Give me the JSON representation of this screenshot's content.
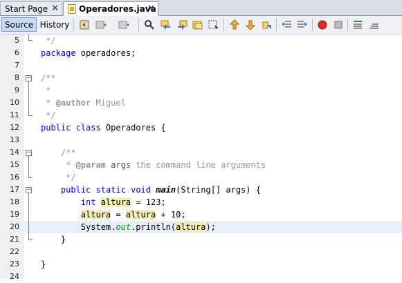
{
  "tabs": [
    {
      "label": "Start Page",
      "active": false
    },
    {
      "label": "Operadores.java",
      "active": true
    }
  ],
  "tab_close_glyph": "✕",
  "toolbar": {
    "source_label": "Source",
    "history_label": "History"
  },
  "editor": {
    "lines": [
      {
        "num": "5",
        "text": " */"
      },
      {
        "num": "6",
        "text": "package operadores;"
      },
      {
        "num": "7",
        "text": ""
      },
      {
        "num": "8",
        "text": "/**"
      },
      {
        "num": "9",
        "text": " *"
      },
      {
        "num": "10",
        "text": " * @author Miguel"
      },
      {
        "num": "11",
        "text": " */"
      },
      {
        "num": "12",
        "text": "public class Operadores {"
      },
      {
        "num": "13",
        "text": ""
      },
      {
        "num": "14",
        "text": "    /**"
      },
      {
        "num": "15",
        "text": "     * @param args the command line arguments"
      },
      {
        "num": "16",
        "text": "     */"
      },
      {
        "num": "17",
        "text": "    public static void main(String[] args) {"
      },
      {
        "num": "18",
        "text": "        int altura = 123;"
      },
      {
        "num": "19",
        "text": "        altura = altura + 10;"
      },
      {
        "num": "20",
        "text": "        System.out.println(altura);"
      },
      {
        "num": "21",
        "text": "    }"
      },
      {
        "num": "22",
        "text": ""
      },
      {
        "num": "23",
        "text": "}"
      },
      {
        "num": "24",
        "text": ""
      }
    ],
    "current_line": "20"
  },
  "colors": {
    "keyword": "#0000e6",
    "comment": "#969696",
    "field": "#009900",
    "occurrence_highlight": "#f0f0b8",
    "current_line": "#e9eff8"
  }
}
